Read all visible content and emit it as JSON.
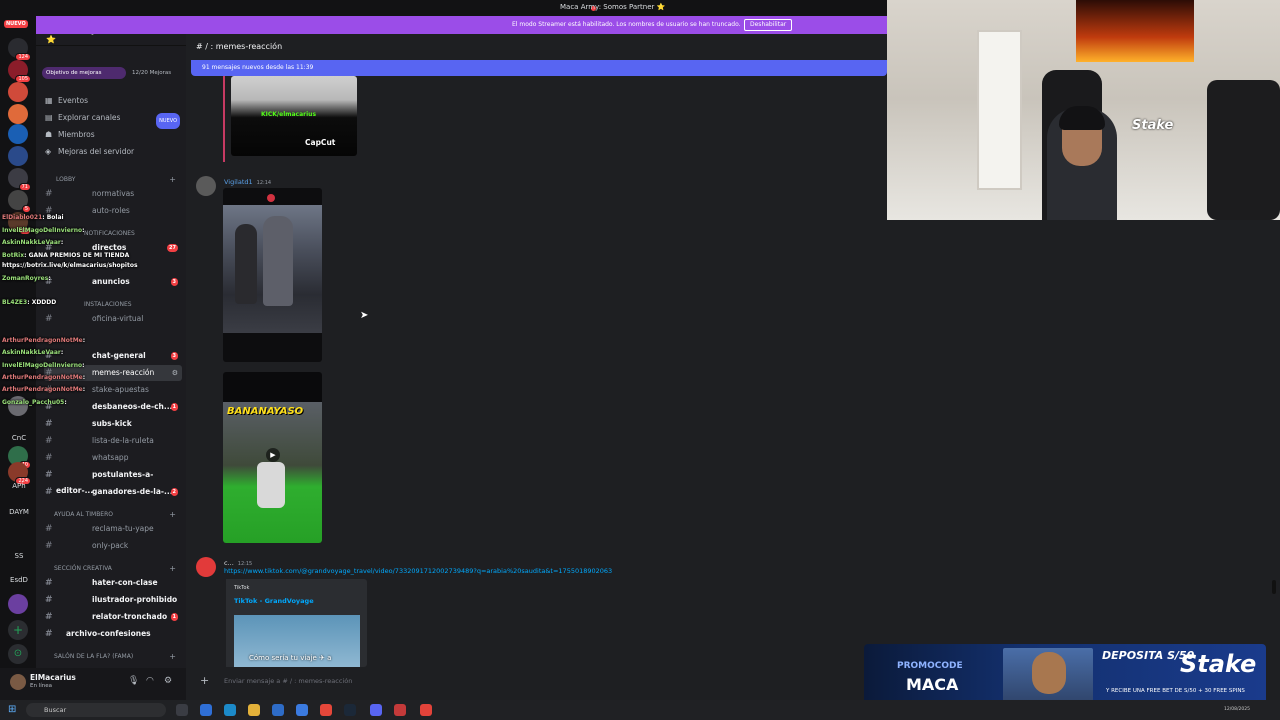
{
  "window": {
    "title": "Maca Army: Somos Partner ⭐"
  },
  "streamer_banner": {
    "text": "El modo Streamer está habilitado. Los nombres de usuario se han truncado.",
    "button": "Deshabilitar"
  },
  "server": {
    "name": "Maca Army: Somos Partner ⭐",
    "boost_label": "Objetivo de mejoras",
    "boost_count": "12/20 Mejoras",
    "boost_progress": 0.6
  },
  "guilds": {
    "nuevo": "NUEVO",
    "badges": [
      "124",
      "105",
      "71",
      "5",
      "61",
      "40",
      "224",
      "APh",
      "DAYM",
      "SS",
      "EsdD",
      "CnC"
    ]
  },
  "nav": [
    {
      "label": "Eventos",
      "icon": "calendar-icon"
    },
    {
      "label": "Explorar canales",
      "icon": "compass-icon",
      "badge": "NUEVO"
    },
    {
      "label": "Miembros",
      "icon": "members-icon"
    },
    {
      "label": "Mejoras del servidor",
      "icon": "boost-icon"
    }
  ],
  "categories": {
    "lobby": "LOBBY",
    "notif": "NOTIFICACIONES",
    "inst": "INSTALACIONES",
    "ayuda": "AYUDA AL TIMBERO",
    "creativa": "SECCIÓN CREATIVA",
    "salon": "SALÓN DE LA FLA? (FAMA)"
  },
  "channels": {
    "normativas": "normativas",
    "auto_roles": "auto-roles",
    "directos": "directos",
    "directos_count": "27",
    "anuncios": "anuncios",
    "anuncios_count": "3",
    "oficina": "oficina-virtual",
    "chat_general": "chat-general",
    "chat_general_count": "3",
    "memes": "memes-reacción",
    "stake": "stake-apuestas",
    "desbaneos": "desbaneos-de-ch...",
    "desbaneos_count": "1",
    "subs": "subs-kick",
    "ruleta": "lista-de-la-ruleta",
    "whatsapp": "whatsapp",
    "postulantes": "postulantes-a-editor-...",
    "ganadores": "ganadores-de-la-...",
    "ganadores_count": "2",
    "yape": "reclama-tu-yape",
    "only": "only-pack",
    "hater": "hater-con-clase",
    "ilustrador": "ilustrador-prohibido",
    "relator": "relator-tronchado",
    "relator_count": "1",
    "archivo": "archivo-confesiones"
  },
  "overlay_chat": [
    {
      "nick": "ElDiablo021",
      "text": ": Bolai"
    },
    {
      "nick": "InvelElMagoDelInvierno",
      "text": ":"
    },
    {
      "nick": "AskinNakkLeVaar",
      "text": ":"
    },
    {
      "nick": "BotRix",
      "text": ": GANA PREMIOS DE MI TIENDA"
    },
    {
      "nick": "",
      "text": "https://botrix.live/k/elmacarius/shopitos"
    },
    {
      "nick": "ZomanRoyres",
      "text": ":"
    },
    {
      "nick": "BL4ZE3",
      "text": ": XDDDD"
    },
    {
      "nick": "ArthurPendragonNotMe",
      "text": ":"
    },
    {
      "nick": "AskinNakkLeVaar",
      "text": ":"
    },
    {
      "nick": "InvelElMagoDelInvierno",
      "text": ":"
    },
    {
      "nick": "ArthurPendragonNotMe",
      "text": ":"
    },
    {
      "nick": "ArthurPendragonNotMe",
      "text": ":"
    },
    {
      "nick": "Gonzalo_Pacchu05",
      "text": ":"
    }
  ],
  "user": {
    "name": "ElMacarius",
    "status": "En línea"
  },
  "header": {
    "channel": "memes-reacción"
  },
  "new_messages": "91 mensajes nuevos desde las 11:39",
  "messages": {
    "img1_watermark": "KICK/elmacarius",
    "img1_capcut": "CapCut",
    "author2": "Vigilatd1",
    "time2": "12:14",
    "img3_title": "BANANAYASO",
    "author3": "c...",
    "time3": "12:15",
    "link": "https://www.tiktok.com/@grandvoyage_travel/video/7332091712002739489?q=arabia%20saudita&t=1755018902063",
    "embed_provider": "TikTok",
    "embed_title": "TikTok - GrandVoyage",
    "embed_caption": "Cómo sería tu viaje ✈ a"
  },
  "composer": {
    "placeholder": "Enviar mensaje a # / : memes-reacción"
  },
  "promo": {
    "code_label": "PROMOCODE",
    "code": "MACA",
    "deposit": "DEPOSITA S/50",
    "deposit_sub": "Y RECIBE UNA FREE BET DE S/50 + 30 FREE SPINS",
    "brand": "Stake"
  },
  "webcam": {
    "overlay": "Stake"
  },
  "taskbar": {
    "search": "Buscar",
    "clock": "12/08/2025"
  },
  "colors": {
    "accent": "#5865f2",
    "streamer": "#9b4de8",
    "link": "#00a8fc",
    "danger": "#f23f43"
  }
}
